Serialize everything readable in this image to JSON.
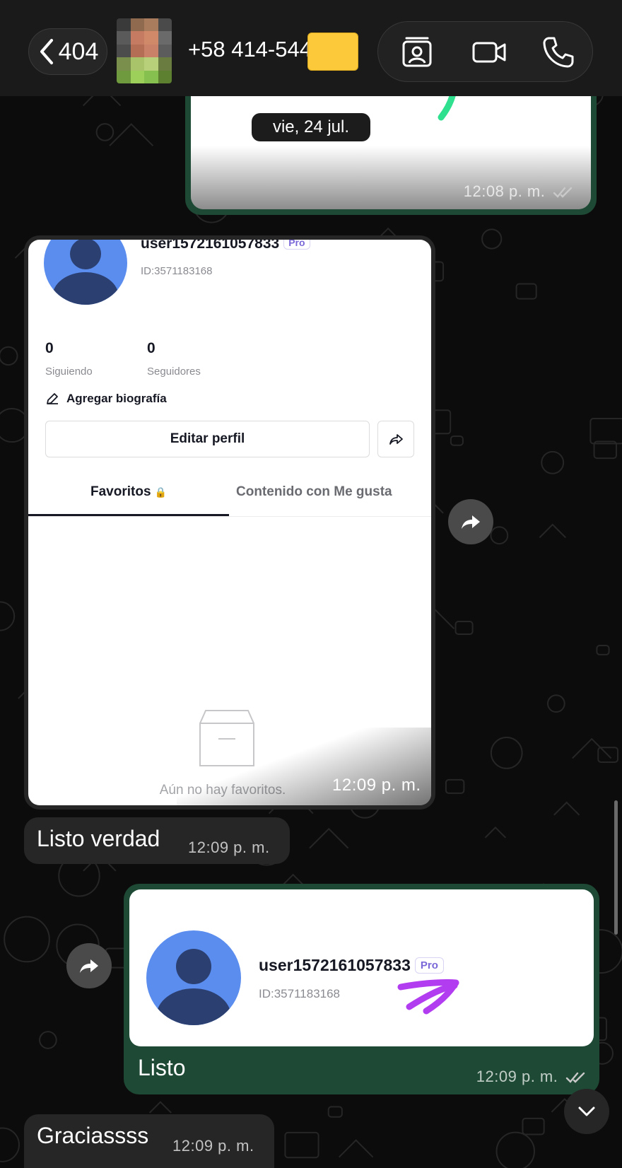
{
  "header": {
    "back_count": "404",
    "contact_name": "+58 414-544",
    "icons": [
      "chevron-left-icon",
      "contact-card-icon",
      "video-call-icon",
      "phone-icon"
    ]
  },
  "date_chip": "vie, 24 jul.",
  "messages": [
    {
      "id": "m1",
      "direction": "sent",
      "type": "image",
      "time": "12:08 p. m.",
      "status": "read"
    },
    {
      "id": "m2",
      "direction": "received",
      "type": "image",
      "time": "12:09 p. m.",
      "screenshot": {
        "username": "user1572161057833",
        "badge": "Pro",
        "user_id": "ID:3571183168",
        "following_count": "0",
        "following_label": "Siguiendo",
        "followers_count": "0",
        "followers_label": "Seguidores",
        "bio_action": "Agregar biografía",
        "edit_button": "Editar perfil",
        "tabs": [
          "Favoritos",
          "Contenido con Me gusta"
        ],
        "empty_text": "Aún no hay favoritos."
      }
    },
    {
      "id": "m3",
      "direction": "received",
      "type": "text",
      "text": "Listo verdad",
      "time": "12:09 p. m."
    },
    {
      "id": "m4",
      "direction": "sent",
      "type": "image",
      "caption": "Listo",
      "time": "12:09 p. m.",
      "status": "read",
      "screenshot": {
        "username": "user1572161057833",
        "badge": "Pro",
        "user_id": "ID:3571183168"
      }
    },
    {
      "id": "m5",
      "direction": "received",
      "type": "text",
      "text": "Graciassss",
      "time": "12:09 p. m."
    }
  ],
  "colors": {
    "sent_bubble": "#1e4a35",
    "received_bubble": "#262626",
    "header_bg": "#1a1a1a",
    "avatar_blue": "#5b8def",
    "pro_badge": "#7b68d8",
    "scribble": "#b23df0",
    "redaction": "#fbc93a"
  }
}
